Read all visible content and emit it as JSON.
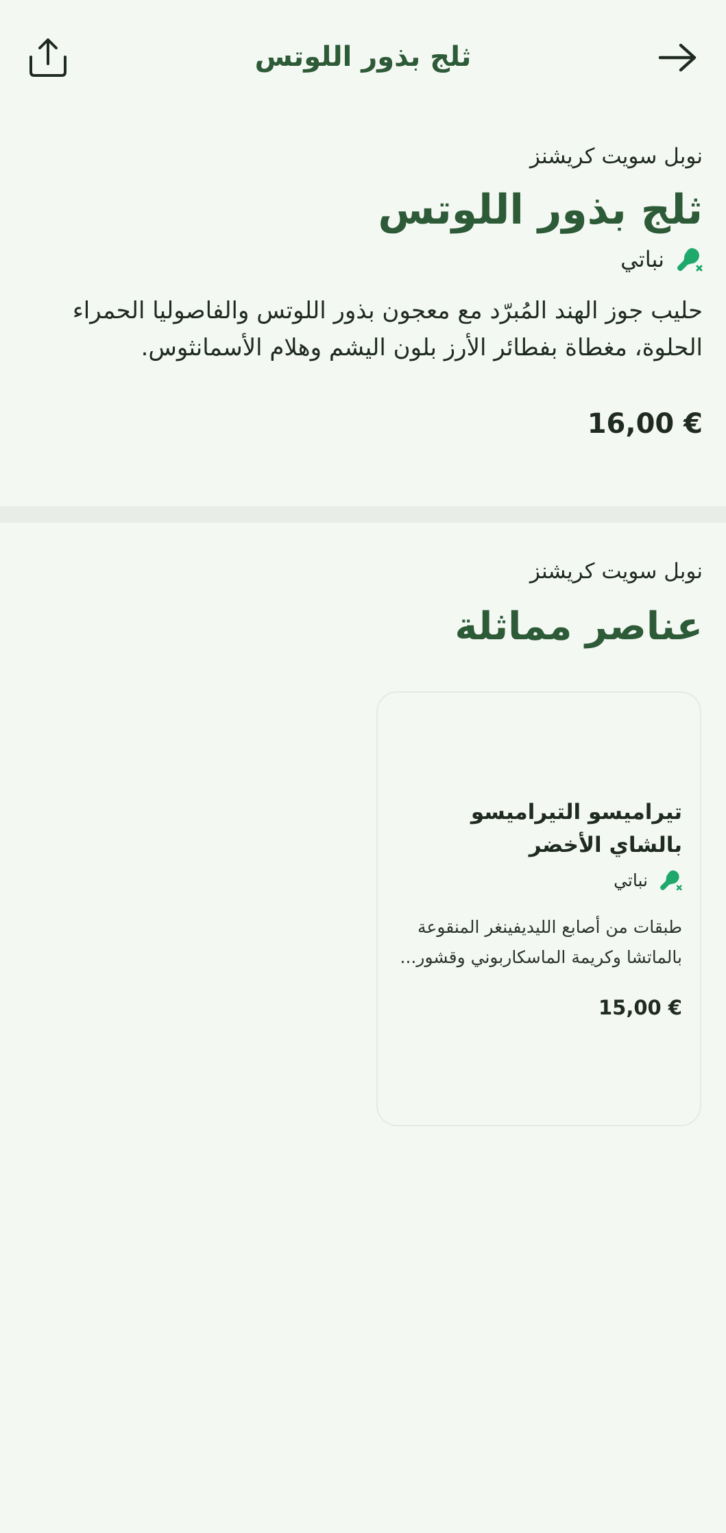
{
  "header": {
    "title": "ثلج بذور اللوتس",
    "share_icon": "share-icon",
    "back_icon": "arrow-right-icon"
  },
  "product": {
    "restaurant": "نوبل سويت كريشنز",
    "title": "ثلج بذور اللوتس",
    "diet_label": "نباتي",
    "description": "حليب جوز الهند المُبرّد مع معجون بذور اللوتس والفاصوليا الحمراء الحلوة، مغطاة بفطائر الأرز بلون اليشم وهلام الأسمانثوس.",
    "price": "16,00 €"
  },
  "similar": {
    "restaurant": "نوبل سويت كريشنز",
    "title": "عناصر مماثلة",
    "items": [
      {
        "title": "تيراميسو التيراميسو بالشاي الأخضر",
        "diet_label": "نباتي",
        "description": "طبقات من أصابع الليديفينغر المنقوعة بالماتشا وكريمة الماسكاربوني وقشور...",
        "price": "15,00 €"
      }
    ]
  },
  "colors": {
    "background": "#f4f8f3",
    "brand_green": "#2d5a37",
    "diet_icon_green": "#1fa86b"
  }
}
